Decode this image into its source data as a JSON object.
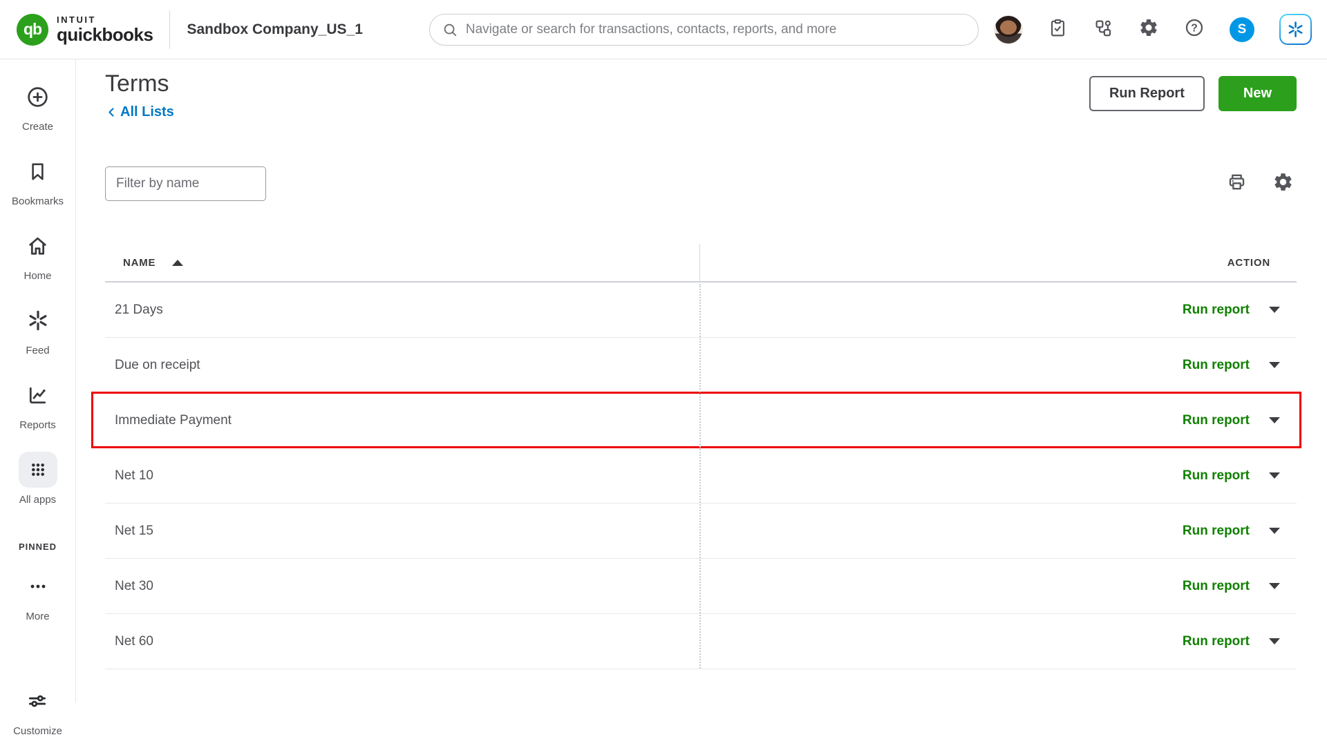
{
  "header": {
    "brand": {
      "monogram": "qb",
      "intuit": "INTUIT",
      "product": "quickbooks"
    },
    "company_name": "Sandbox Company_US_1",
    "search": {
      "placeholder": "Navigate or search for transactions, contacts, reports, and more"
    },
    "user_initial": "S",
    "icons": [
      "avatar",
      "tasks-clipboard-icon",
      "workflows-icon",
      "settings-gear-icon",
      "help-icon",
      "user-initial-badge",
      "intuit-assist-icon"
    ]
  },
  "sidebar": {
    "items": [
      {
        "label": "Create",
        "icon": "plus-circle-icon"
      },
      {
        "label": "Bookmarks",
        "icon": "bookmark-icon"
      },
      {
        "label": "Home",
        "icon": "home-icon"
      },
      {
        "label": "Feed",
        "icon": "spark-icon"
      },
      {
        "label": "Reports",
        "icon": "line-chart-icon"
      },
      {
        "label": "All apps",
        "icon": "apps-grid-icon",
        "active": true
      }
    ],
    "pinned_label": "PINNED",
    "more": {
      "label": "More",
      "icon": "ellipsis-icon"
    },
    "customize": {
      "label": "Customize",
      "icon": "sliders-icon"
    }
  },
  "page": {
    "title": "Terms",
    "back_link": "All Lists",
    "run_report_button": "Run Report",
    "new_button": "New",
    "filter_placeholder": "Filter by name",
    "tools": [
      "printer-icon",
      "gear-icon"
    ]
  },
  "table": {
    "columns": {
      "name": "NAME",
      "action": "ACTION"
    },
    "sort": {
      "column": "NAME",
      "direction": "ascending"
    },
    "rows": [
      {
        "name": "21 Days",
        "action": "Run report"
      },
      {
        "name": "Due on receipt",
        "action": "Run report"
      },
      {
        "name": "Immediate Payment",
        "action": "Run report",
        "highlighted": true
      },
      {
        "name": "Net 10",
        "action": "Run report"
      },
      {
        "name": "Net 15",
        "action": "Run report"
      },
      {
        "name": "Net 30",
        "action": "Run report"
      },
      {
        "name": "Net 60",
        "action": "Run report"
      }
    ]
  },
  "colors": {
    "brand_green": "#2ca01c",
    "action_link_green": "#108000",
    "link_blue": "#0077c5",
    "highlight_red": "#ec0000",
    "avatar_badge_blue": "#0097e6",
    "text_dark": "#393a3d",
    "text_gray": "#6b6c72"
  }
}
